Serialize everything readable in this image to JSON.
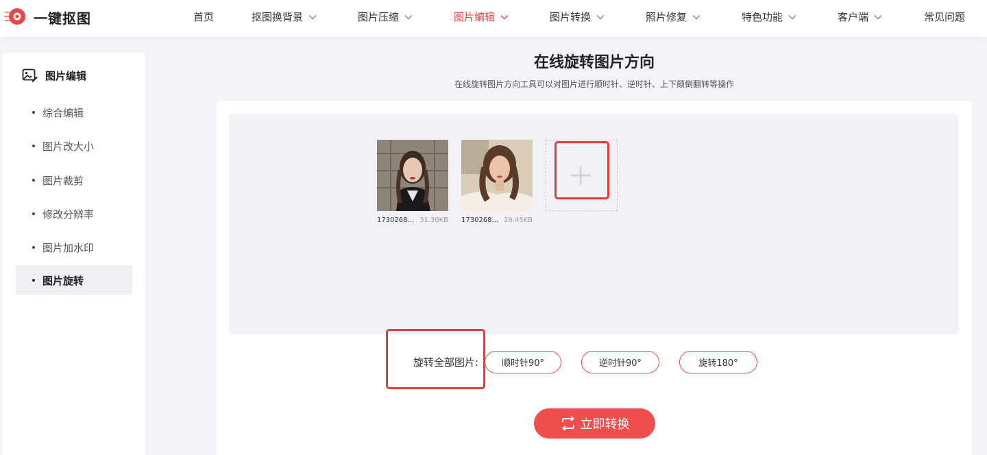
{
  "brand": {
    "name": "一键抠图",
    "accent": "#ef4444"
  },
  "nav": [
    {
      "label": "首页",
      "has_dropdown": false,
      "active": false
    },
    {
      "label": "抠图换背景",
      "has_dropdown": true,
      "active": false
    },
    {
      "label": "图片压缩",
      "has_dropdown": true,
      "active": false
    },
    {
      "label": "图片编辑",
      "has_dropdown": true,
      "active": true
    },
    {
      "label": "图片转换",
      "has_dropdown": true,
      "active": false
    },
    {
      "label": "照片修复",
      "has_dropdown": true,
      "active": false
    },
    {
      "label": "特色功能",
      "has_dropdown": true,
      "active": false
    },
    {
      "label": "客户端",
      "has_dropdown": true,
      "active": false
    },
    {
      "label": "常见问题",
      "has_dropdown": false,
      "active": false
    }
  ],
  "sidebar": {
    "title": "图片编辑",
    "items": [
      {
        "label": "综合编辑",
        "active": false
      },
      {
        "label": "图片改大小",
        "active": false
      },
      {
        "label": "图片裁剪",
        "active": false
      },
      {
        "label": "修改分辨率",
        "active": false
      },
      {
        "label": "图片加水印",
        "active": false
      },
      {
        "label": "图片旋转",
        "active": true
      }
    ]
  },
  "page": {
    "title": "在线旋转图片方向",
    "subtitle": "在线旋转图片方向工具可以对图片进行顺时针、逆时针、上下颠倒翻转等操作"
  },
  "files": [
    {
      "name": "1730268...",
      "size": "31.30KB",
      "icon": "portrait-photo-braids"
    },
    {
      "name": "1730268...",
      "size": "29.45KB",
      "icon": "portrait-photo-offshoulder"
    }
  ],
  "rotate": {
    "label": "旋转全部图片:",
    "buttons": [
      {
        "label": "顺时针90°"
      },
      {
        "label": "逆时针90°"
      },
      {
        "label": "旋转180°"
      }
    ]
  },
  "convert": {
    "label": "立即转换"
  },
  "colors": {
    "highlight": "#e53d2f",
    "button": "#ef4e4e"
  }
}
